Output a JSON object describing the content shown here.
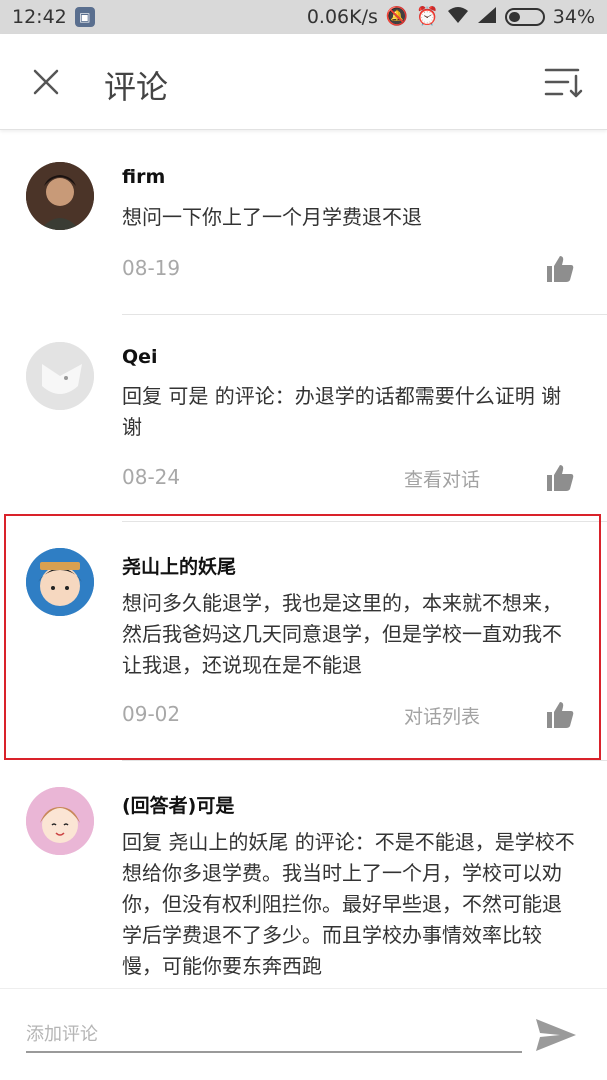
{
  "status_bar": {
    "time": "12:42",
    "speed": "0.06K/s",
    "battery": "34%",
    "battery_level": 0.34
  },
  "header": {
    "title": "评论",
    "close_icon": "close-icon",
    "sort_icon": "sort-icon"
  },
  "comments": [
    {
      "name": "firm",
      "text": "想问一下你上了一个月学费退不退",
      "date": "08-19",
      "action": ""
    },
    {
      "name": "Qei",
      "text": "回复 可是 的评论：办退学的话都需要什么证明 谢谢",
      "date": "08-24",
      "action": "查看对话"
    },
    {
      "name": "尧山上的妖尾",
      "text": "想问多久能退学，我也是这里的，本来就不想来，然后我爸妈这几天同意退学，但是学校一直劝我不让我退，还说现在是不能退",
      "date": "09-02",
      "action": "对话列表"
    },
    {
      "name": "(回答者)可是",
      "text": "回复 尧山上的妖尾 的评论：不是不能退，是学校不想给你多退学费。我当时上了一个月，学校可以劝你，但没有权利阻拦你。最好早些退，不然可能退学后学费退不了多少。而且学校办事情效率比较慢，可能你要东奔西跑",
      "date": "",
      "action": ""
    }
  ],
  "composer": {
    "placeholder": "添加评论",
    "send_icon": "send-icon"
  },
  "colors": {
    "highlight": "#d9222a",
    "muted_text": "#a8a8a8"
  }
}
